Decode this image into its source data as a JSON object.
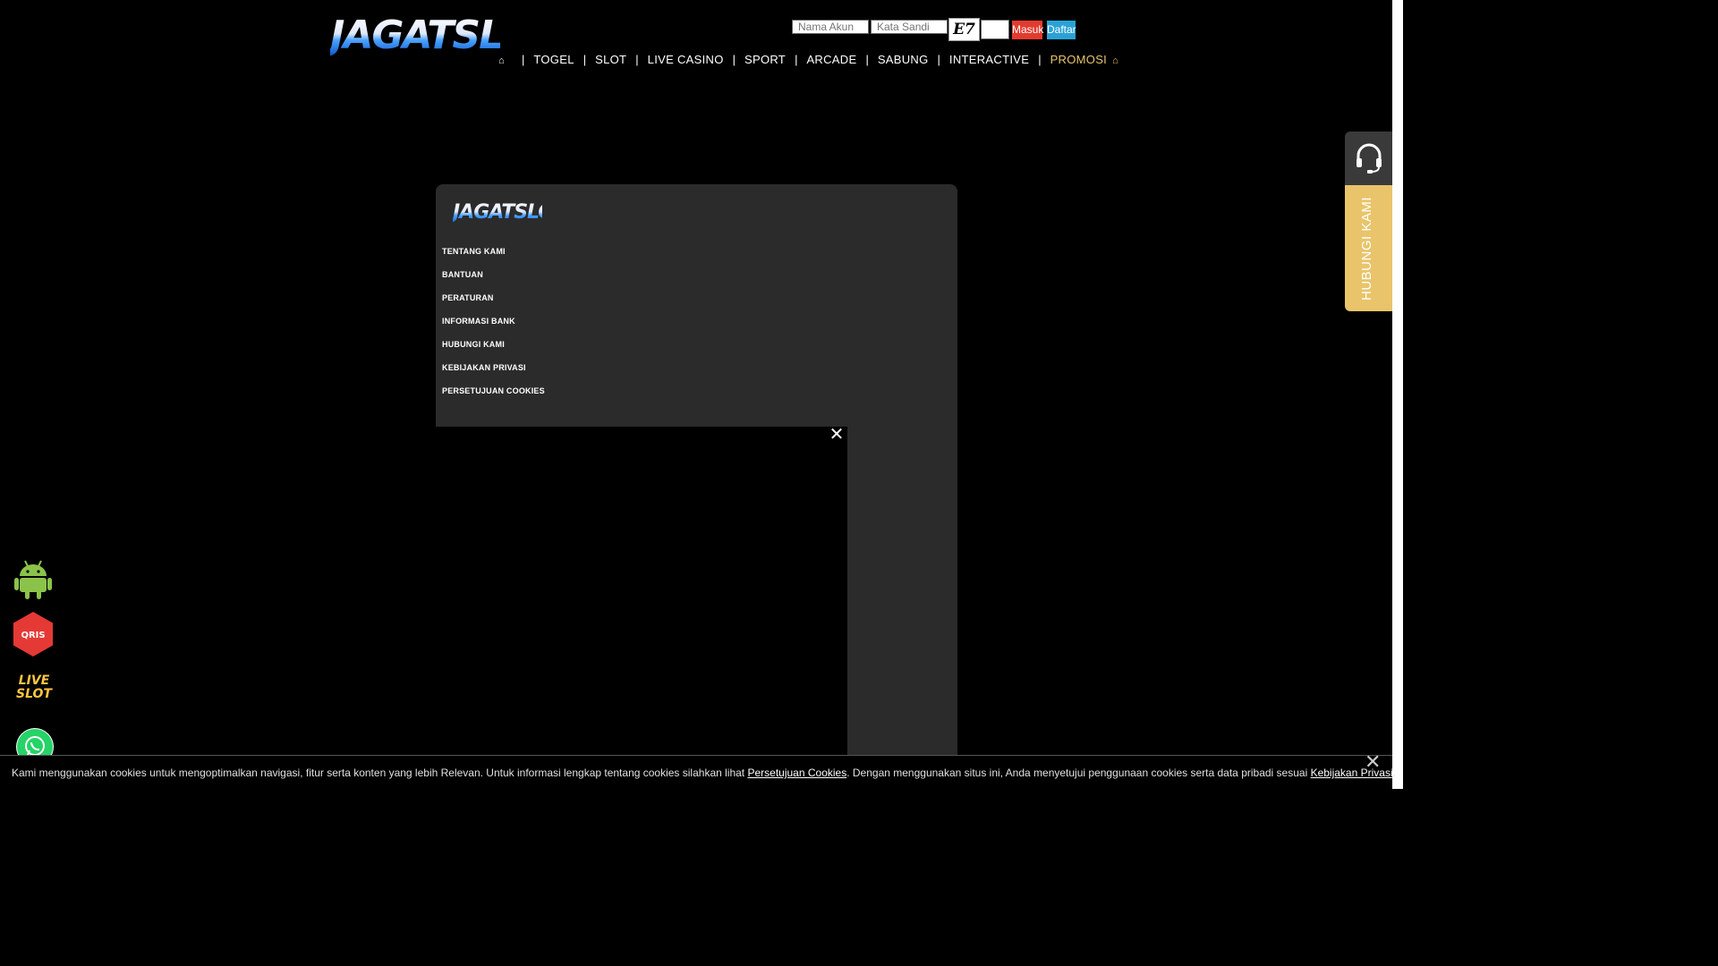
{
  "header": {
    "logo": "JAGATSLOT",
    "login": {
      "username_placeholder": "Nama Akun",
      "password_placeholder": "Kata Sandi",
      "captcha": "E7",
      "login_label": "Masuk",
      "register_label": "Daftar"
    },
    "nav": [
      {
        "label": "TOGEL"
      },
      {
        "label": "SLOT"
      },
      {
        "label": "LIVE CASINO"
      },
      {
        "label": "SPORT"
      },
      {
        "label": "ARCADE"
      },
      {
        "label": "SABUNG"
      },
      {
        "label": "INTERACTIVE"
      },
      {
        "label": "PROMOSI"
      }
    ]
  },
  "footer": {
    "logo": "JAGATSLOT",
    "links": [
      "TENTANG KAMI",
      "BANTUAN",
      "PERATURAN",
      "INFORMASI BANK",
      "HUBUNGI KAMI",
      "KEBIJAKAN PRIVASI",
      "PERSETUJUAN COOKIES"
    ]
  },
  "contact_tab": {
    "label": "HUBUNGI KAMI",
    "icon": "headset-icon"
  },
  "float_icons": {
    "android": "android-icon",
    "qris": "QRIS",
    "liveslot_line1": "LIVE",
    "liveslot_line2": "SLOT",
    "whatsapp": "whatsapp-icon"
  },
  "cookie_bar": {
    "text_before": "Kami menggunakan cookies untuk mengoptimalkan navigasi, fitur serta konten yang lebih Relevan. Untuk informasi lengkap tentang cookies silahkan lihat ",
    "link1": "Persetujuan Cookies",
    "text_middle": ". Dengan menggunakan situs ini, Anda menyetujui penggunaan cookies serta data pribadi sesuai ",
    "link2": "Kebijakan Privasi",
    "text_after": "."
  },
  "colors": {
    "background": "#000000",
    "panel": "#2b2b2b",
    "accent_gold": "#e9c46a",
    "login_button": "#e23b2f",
    "register_button": "#2aa2d6"
  }
}
